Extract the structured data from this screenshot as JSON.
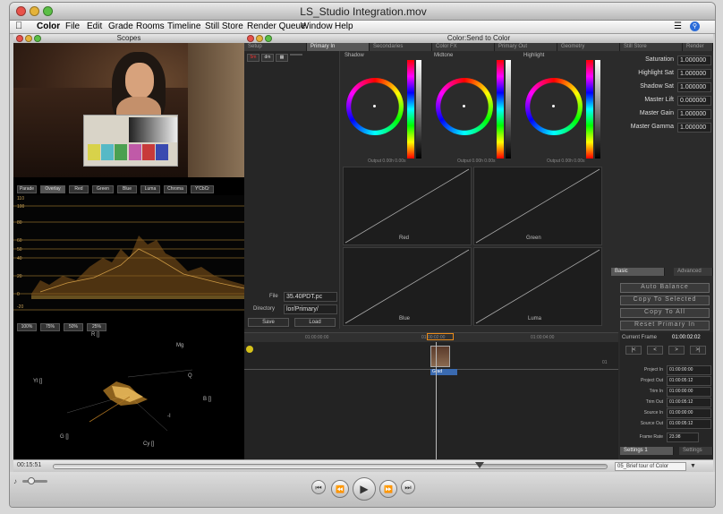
{
  "window": {
    "title": "LS_Studio Integration.mov"
  },
  "menubar": {
    "items": [
      "Color",
      "File",
      "Edit",
      "Grade",
      "Rooms",
      "Timeline",
      "Still Store",
      "Render Queue",
      "Window",
      "Help"
    ]
  },
  "scopes": {
    "title": "Scopes",
    "mode_buttons": [
      "Parade",
      "Overlay",
      "Red",
      "Green",
      "Blue",
      "Luma",
      "Chroma",
      "Y'CbCr"
    ],
    "waveform_ticks": [
      "110",
      "100",
      "80",
      "60",
      "50",
      "40",
      "20",
      "0",
      "-20"
    ],
    "vector_buttons": [
      "100%",
      "75%",
      "50%",
      "25%"
    ],
    "vector_targets": {
      "r": "R []",
      "mg": "Mg",
      "yl": "Yl []",
      "b": "B []",
      "g": "G []",
      "cy": "Cy []",
      "q": "Q",
      "i": "-I"
    }
  },
  "color": {
    "title": "Color:Send to Color",
    "tabs": [
      "Setup",
      "Primary In",
      "Secondaries",
      "Color FX",
      "Primary Out",
      "Geometry",
      "Still Store",
      "Render"
    ],
    "toolbar_buttons": [
      "5m",
      "dm"
    ],
    "wheels": [
      {
        "label": "Shadow",
        "output": "Output 0.00h 0.00s"
      },
      {
        "label": "Midtone",
        "output": "Output 0.00h 0.00s"
      },
      {
        "label": "Highlight",
        "output": "Output 0.00h 0.00s"
      }
    ],
    "curves": [
      "Red",
      "Green",
      "Blue",
      "Luma"
    ],
    "params": [
      {
        "label": "Saturation",
        "value": "1.000000"
      },
      {
        "label": "Highlight Sat",
        "value": "1.000000"
      },
      {
        "label": "Shadow Sat",
        "value": "1.000000"
      },
      {
        "label": "Master Lift",
        "value": "0.000000"
      },
      {
        "label": "Master Gain",
        "value": "1.000000"
      },
      {
        "label": "Master Gamma",
        "value": "1.000000"
      }
    ],
    "basic_tab": "Basic",
    "advanced_tab": "Advanced",
    "right_buttons": [
      "Auto Balance",
      "Copy To Selected",
      "Copy To All",
      "Reset Primary In"
    ],
    "file_label": "File",
    "file_value": "35.40PDT.pc",
    "directory_label": "Directory",
    "directory_value": "lor/Primary/",
    "save_btn": "Save",
    "load_btn": "Load",
    "current_frame_label": "Current Frame",
    "current_frame_value": "01:00:02:02",
    "timeline_ruler": [
      "01:00:00:00",
      "01:00:02:00",
      "01:00:04:00"
    ],
    "timeline_marker": "01",
    "clip_label": "Grad",
    "nav_buttons": [
      "|<",
      "<",
      ">",
      ">|"
    ],
    "timecodes": [
      {
        "label": "Project In",
        "value": "01:00:00:00"
      },
      {
        "label": "Project Out",
        "value": "01:00:05:12"
      },
      {
        "label": "Trim In",
        "value": "01:00:00:00"
      },
      {
        "label": "Trim Out",
        "value": "01:00:05:12"
      },
      {
        "label": "Source In",
        "value": "01:00:00:00"
      },
      {
        "label": "Source Out",
        "value": "01:00:05:12"
      }
    ],
    "frame_rate_label": "Frame Rate",
    "frame_rate_value": "23.98",
    "settings_tabs": [
      "Settings 1",
      "Settings"
    ]
  },
  "player": {
    "current_time": "00:15:51",
    "playback_progress": 0.77,
    "chapter": "05_Brief tour of Color",
    "volume_level": 0.35
  }
}
